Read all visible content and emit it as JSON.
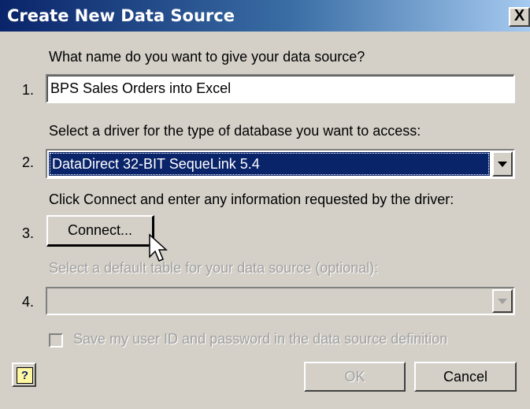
{
  "window": {
    "title": "Create New Data Source",
    "close_label": "X"
  },
  "step1": {
    "number": "1.",
    "prompt": "What name do you want to give your data source?",
    "value": "BPS Sales Orders into Excel"
  },
  "step2": {
    "number": "2.",
    "prompt": "Select a driver for the type of database you want to access:",
    "selected": "DataDirect 32-BIT SequeLink 5.4"
  },
  "step3": {
    "number": "3.",
    "prompt": "Click Connect and enter any information requested by the driver:",
    "button_label": "Connect..."
  },
  "step4": {
    "number": "4.",
    "prompt": "Select a default table for your data source (optional):",
    "selected": ""
  },
  "save_credentials": {
    "label": "Save my user ID and password in the data source definition",
    "checked": false
  },
  "footer": {
    "help_icon": "?",
    "ok_label": "OK",
    "cancel_label": "Cancel"
  },
  "colors": {
    "titlebar": "#0a246a",
    "selection": "#0a246a",
    "face": "#d4d0c8",
    "disabled_text": "#a0a0a0"
  }
}
